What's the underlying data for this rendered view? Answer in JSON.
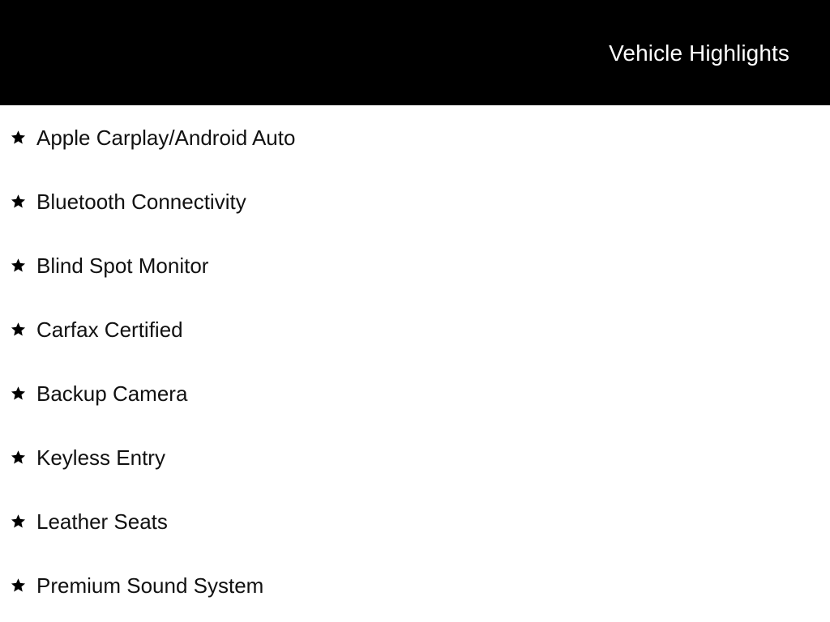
{
  "header": {
    "title": "Vehicle Highlights",
    "background_color": "#000000",
    "text_color": "#ffffff"
  },
  "page": {
    "background_color": "#ffffff",
    "text_color": "#111111"
  },
  "highlights": {
    "bullet_icon": "star-icon",
    "items": [
      {
        "label": "Apple Carplay/Android Auto"
      },
      {
        "label": "Bluetooth Connectivity"
      },
      {
        "label": "Blind Spot Monitor"
      },
      {
        "label": "Carfax Certified"
      },
      {
        "label": "Backup Camera"
      },
      {
        "label": "Keyless Entry"
      },
      {
        "label": "Leather Seats"
      },
      {
        "label": "Premium Sound System"
      }
    ]
  }
}
